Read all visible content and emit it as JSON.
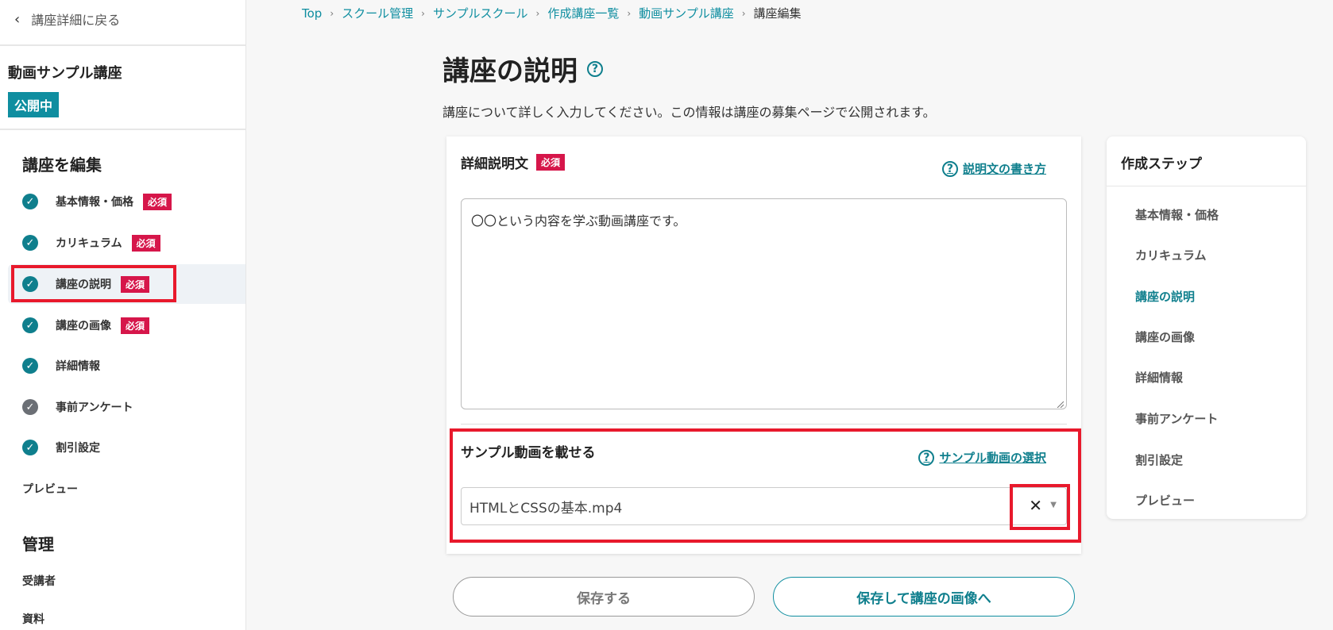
{
  "sidebar": {
    "back_label": "講座詳細に戻る",
    "course_title": "動画サンプル講座",
    "status": "公開中",
    "edit_heading": "講座を編集",
    "items": [
      {
        "label": "基本情報・価格",
        "required": "必須",
        "status": "done"
      },
      {
        "label": "カリキュラム",
        "required": "必須",
        "status": "done"
      },
      {
        "label": "講座の説明",
        "required": "必須",
        "status": "done",
        "active": true
      },
      {
        "label": "講座の画像",
        "required": "必須",
        "status": "done"
      },
      {
        "label": "詳細情報",
        "status": "done"
      },
      {
        "label": "事前アンケート",
        "status": "pending"
      },
      {
        "label": "割引設定",
        "status": "done"
      }
    ],
    "preview_label": "プレビュー",
    "manage_heading": "管理",
    "manage_items": [
      "受講者",
      "資料"
    ]
  },
  "breadcrumb": [
    "Top",
    "スクール管理",
    "サンプルスクール",
    "作成講座一覧",
    "動画サンプル講座",
    "講座編集"
  ],
  "main": {
    "title": "講座の説明",
    "description": "講座について詳しく入力してください。この情報は講座の募集ページで公開されます。",
    "detail_label": "詳細説明文",
    "detail_required": "必須",
    "detail_help": "説明文の書き方",
    "detail_value": "〇〇という内容を学ぶ動画講座です。",
    "sample_label": "サンプル動画を載せる",
    "sample_help": "サンプル動画の選択",
    "sample_value": "HTMLとCSSの基本.mp4",
    "save_button": "保存する",
    "next_button": "保存して講座の画像へ"
  },
  "steps": {
    "title": "作成ステップ",
    "items": [
      "基本情報・価格",
      "カリキュラム",
      "講座の説明",
      "講座の画像",
      "詳細情報",
      "事前アンケート",
      "割引設定",
      "プレビュー"
    ],
    "active_index": 2
  },
  "colors": {
    "accent": "#0f7f8d",
    "required": "#d6164a",
    "highlight": "#e8192c"
  }
}
